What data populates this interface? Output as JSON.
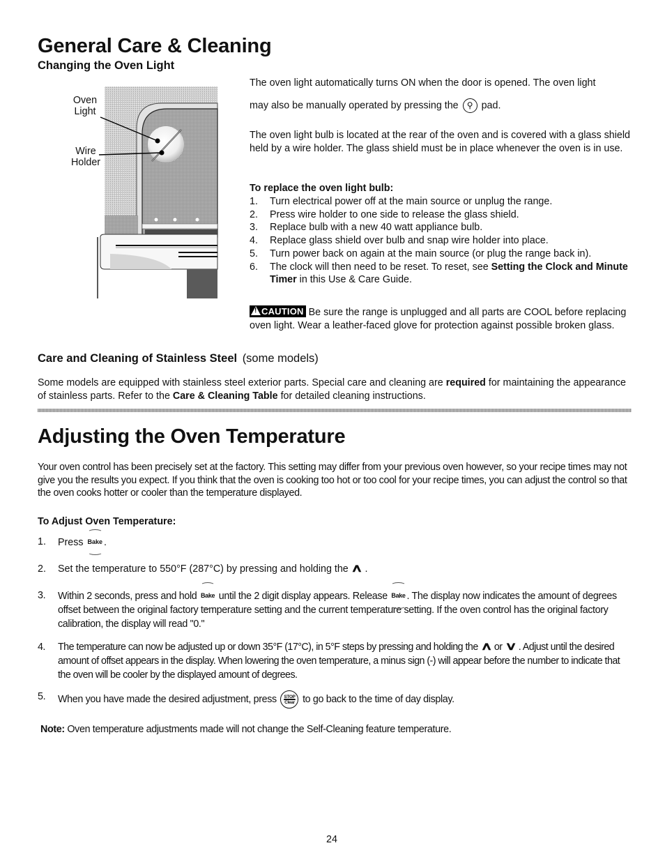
{
  "page": {
    "title": "General Care & Cleaning",
    "page_number": "24"
  },
  "oven_light": {
    "heading": "Changing the Oven Light",
    "figure": {
      "label_oven_light_1": "Oven",
      "label_oven_light_2": "Light",
      "label_wire_holder_1": "Wire",
      "label_wire_holder_2": "Holder"
    },
    "intro_line1": "The oven light automatically turns ON when the door is opened. The oven light",
    "intro_line2_before": "may also be manually operated by pressing the",
    "intro_line2_icon": "light-bulb-pad-icon",
    "intro_line2_after": "pad.",
    "location_text": "The oven light bulb is located at the rear of the oven and is covered with a glass shield held by a wire holder. The glass shield must be in place whenever the oven is in use.",
    "replace_heading": "To replace the oven light bulb:",
    "steps": [
      {
        "num": "1.",
        "text": "Turn electrical power off at the main source or unplug the range."
      },
      {
        "num": "2.",
        "text": "Press wire holder to one side to release the glass shield."
      },
      {
        "num": "3.",
        "text": "Replace bulb with a new 40 watt appliance bulb."
      },
      {
        "num": "4.",
        "text": "Replace glass shield over bulb and snap wire holder into place."
      },
      {
        "num": "5.",
        "text": "Turn power back on again at the main source (or plug the range back in)."
      },
      {
        "num": "6.",
        "text_before": "The clock will then need to be reset. To reset, see ",
        "text_bold": "Setting the Clock and Minute Timer",
        "text_after": " in this Use & Care Guide."
      }
    ],
    "caution": {
      "badge": "CAUTION",
      "text": "Be sure the range is unplugged and all parts are COOL before replacing  oven light. Wear a leather-faced glove for protection against possible broken glass."
    }
  },
  "stainless": {
    "heading_bold": "Care and Cleaning of Stainless Steel",
    "heading_light": "(some models)",
    "p_part1": "Some models are equipped with stainless steel exterior parts. Special care and cleaning are ",
    "p_bold1": "required",
    "p_part2": " for maintaining the appearance of stainless parts. Refer to the ",
    "p_bold2": "Care & Cleaning Table",
    "p_part3": " for detailed cleaning instructions."
  },
  "adjust": {
    "title": "Adjusting the Oven Temperature",
    "intro": "Your oven control has been precisely set at the factory. This setting may differ from your previous oven however, so your recipe times may not give you the results you expect. If you think that the oven is cooking too hot or too cool for your recipe times, you can adjust the control so that the oven cooks hotter or cooler than the temperature displayed.",
    "subheading": "To Adjust Oven Temperature:",
    "bake_key": "Bake",
    "stop_key_top": "STOP",
    "stop_key_bottom": "Clear",
    "up_arrow": "∧",
    "down_arrow": "∨",
    "step1": {
      "num": "1.",
      "before": "Press",
      "after": "."
    },
    "step2": {
      "num": "2.",
      "before": "Set the temperature to 550°F (287°C) by pressing and holding the",
      "after": "."
    },
    "step3": {
      "num": "3.",
      "a": "Within 2 seconds, press and hold",
      "b": "until the 2 digit display appears. Release",
      "c": ". The display now indicates the amount of degrees offset between the original factory temperature setting and the current temperature setting. If the oven control has the original factory calibration, the display will read \"0.\""
    },
    "step4": {
      "num": "4.",
      "a": "The temperature can now be adjusted up or down 35°F (17°C), in 5°F steps by pressing and holding the",
      "or": "or",
      "b": ". Adjust until the desired amount of offset appears in the display. When lowering the oven temperature, a minus sign (-) will appear before the number to indicate that the oven will be cooler by the displayed amount of degrees."
    },
    "step5": {
      "num": "5.",
      "before": "When you have made the desired adjustment, press",
      "after": "to go back to the time of day display."
    },
    "note_label": "Note:",
    "note_text": " Oven temperature adjustments made will not change the Self-Cleaning feature temperature."
  }
}
